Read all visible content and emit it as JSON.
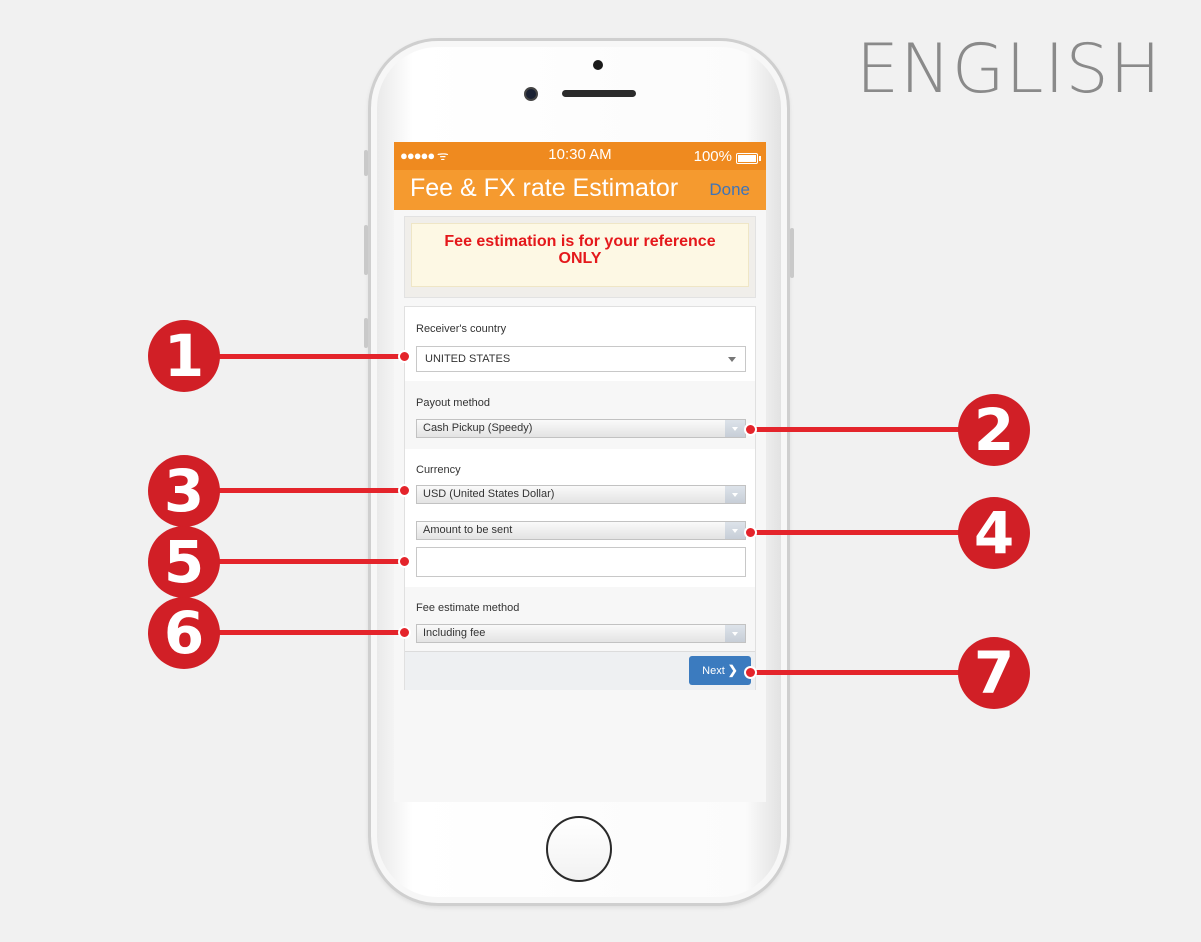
{
  "page": {
    "language_label": "ENGLISH"
  },
  "status_bar": {
    "signal": "●●●●● ᯤ",
    "time": "10:30 AM",
    "battery": "100%"
  },
  "nav": {
    "title": "Fee & FX rate Estimator",
    "done_label": "Done"
  },
  "notice": {
    "line1": "Fee estimation is for your reference",
    "line2": "ONLY"
  },
  "form": {
    "receiver_country": {
      "label": "Receiver's country",
      "value": "UNITED STATES"
    },
    "payout_method": {
      "label": "Payout method",
      "value": "Cash Pickup (Speedy)"
    },
    "currency": {
      "label": "Currency",
      "value": "USD (United States Dollar)"
    },
    "amount": {
      "type_value": "Amount to be sent",
      "value": ""
    },
    "fee_method": {
      "label": "Fee estimate method",
      "value": "Including fee"
    },
    "next_label": "Next",
    "next_icon": "chevron-right-icon"
  },
  "callouts": [
    "1",
    "2",
    "3",
    "4",
    "5",
    "6",
    "7"
  ],
  "colors": {
    "status_orange": "#ef8a1f",
    "nav_orange": "#f59a2f",
    "notice_red": "#e4181b",
    "callout_red": "#d11f26",
    "button_blue": "#3b7bbf"
  }
}
